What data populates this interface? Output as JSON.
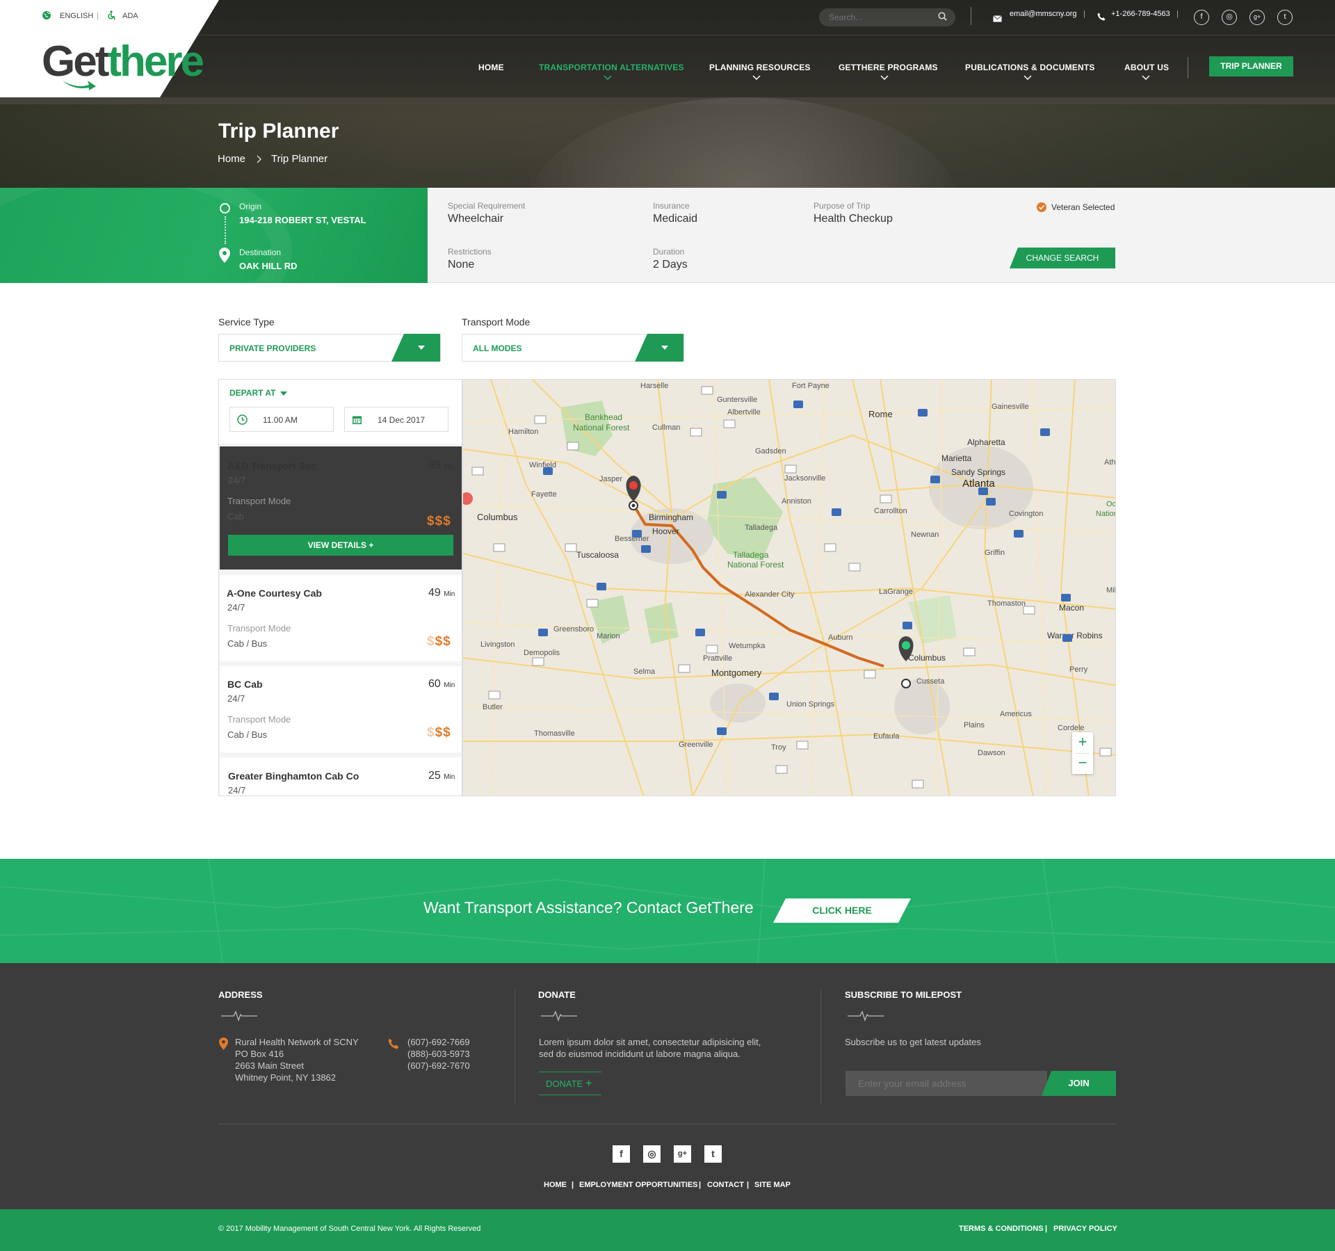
{
  "topbar": {
    "language": "ENGLISH",
    "ada": "ADA",
    "search_placeholder": "Search...",
    "email": "email@mmscny.org",
    "phone": "+1-266-789-4563"
  },
  "brand": {
    "logo_part1": "Get",
    "logo_part2": "there"
  },
  "nav": {
    "items": [
      "HOME",
      "TRANSPORTATION ALTERNATIVES",
      "PLANNING RESOURCES",
      "GETTHERE PROGRAMS",
      "PUBLICATIONS & DOCUMENTS",
      "ABOUT US"
    ],
    "cta": "TRIP PLANNER"
  },
  "hero": {
    "title": "Trip Planner",
    "breadcrumb": [
      "Home",
      "Trip Planner"
    ]
  },
  "trip": {
    "origin_label": "Origin",
    "origin": "194-218 ROBERT ST, VESTAL",
    "destination_label": "Destination",
    "destination": "OAK HILL RD"
  },
  "summary": {
    "special_label": "Special Requirement",
    "special": "Wheelchair",
    "insurance_label": "Insurance",
    "insurance": "Medicaid",
    "purpose_label": "Purpose of Trip",
    "purpose": "Health Checkup",
    "veteran": "Veteran Selected",
    "restrictions_label": "Restrictions",
    "restrictions": "None",
    "duration_label": "Duration",
    "duration": "2 Days",
    "change_button": "CHANGE SEARCH"
  },
  "filters": {
    "service_label": "Service Type",
    "service_value": "PRIVATE PROVIDERS",
    "mode_label": "Transport Mode",
    "mode_value": "ALL MODES"
  },
  "depart": {
    "label": "DEPART AT",
    "time": "11.00 AM",
    "date": "14 Dec 2017"
  },
  "results": [
    {
      "name": "A&D Transport Svc",
      "hours": "24/7",
      "minutes": "45",
      "min_unit": "Min",
      "mode_label": "Transport Mode",
      "mode": "Cab",
      "price": "$$$",
      "price_level": 3
    },
    {
      "name": "A-One Courtesy Cab",
      "hours": "24/7",
      "minutes": "49",
      "min_unit": "Min",
      "mode_label": "Transport Mode",
      "mode": "Cab / Bus",
      "price": "$$$",
      "price_level": 2
    },
    {
      "name": "BC Cab",
      "hours": "24/7",
      "minutes": "60",
      "min_unit": "Min",
      "mode_label": "Transport Mode",
      "mode": "Cab / Bus",
      "price": "$$$",
      "price_level": 2
    },
    {
      "name": "Greater Binghamton Cab Co",
      "hours": "24/7",
      "minutes": "25",
      "min_unit": "Min"
    }
  ],
  "view_details": "VIEW DETAILS +",
  "map": {
    "cities": [
      "Harselle",
      "Guntersville",
      "Fort Payne",
      "Rome",
      "Gainesville",
      "Albertville",
      "Hamilton",
      "Cullman",
      "Alpharetta",
      "Marietta",
      "Sandy Springs",
      "Atlanta",
      "Winfield",
      "Jasper",
      "Gadsden",
      "Jacksonville",
      "Fayette",
      "Columbus",
      "Birmingham",
      "Hoover",
      "Anniston",
      "Carrollton",
      "Covington",
      "Bessemer",
      "Talladega",
      "Newnan",
      "Griffin",
      "Tuscaloosa",
      "Alexander City",
      "LaGrange",
      "Thomaston",
      "Macon",
      "Greensboro",
      "Marion",
      "Livingston",
      "Demopolis",
      "Auburn",
      "Warner Robins",
      "Prattville",
      "Wetumpka",
      "Selma",
      "Montgomery",
      "Cusseta",
      "Perry",
      "Union Springs",
      "Butler",
      "Americus",
      "Thomasville",
      "Plains",
      "Cordele",
      "Greenville",
      "Troy",
      "Eufaula",
      "Dawson",
      "Athe",
      "Oco",
      "Nationa",
      "Mil",
      "Atlanta"
    ],
    "forests": [
      "Bankhead",
      "National Forest",
      "Talladega",
      "National Forest"
    ],
    "route_city": "Columbus",
    "zoom_in": "+",
    "zoom_out": "−"
  },
  "cta": {
    "text": "Want Transport Assistance? Contact GetThere",
    "button": "CLICK HERE"
  },
  "footer": {
    "address_head": "ADDRESS",
    "address": [
      "Rural Health Network of SCNY",
      "PO Box 416",
      "2663 Main Street",
      "Whitney Point, NY 13862"
    ],
    "phones": [
      "(607)-692-7669",
      "(888)-603-5973",
      "(607)-692-7670"
    ],
    "donate_head": "DONATE",
    "donate_text": [
      "Lorem ipsum dolor sit amet, consectetur adipisicing elit,",
      "sed do eiusmod incididunt ut labore magna aliqua."
    ],
    "donate_link": "DONATE",
    "subscribe_head": "SUBSCRIBE TO MILEPOST",
    "subscribe_text": "Subscribe us to get latest updates",
    "email_placeholder": "Enter your email address",
    "join": "JOIN",
    "links": [
      "HOME",
      "EMPLOYMENT OPPORTUNITIES",
      "CONTACT",
      "SITE MAP"
    ],
    "copyright": "© 2017 Mobility Management of South Central New York. All Rights Reserved",
    "terms": "TERMS & CONDITIONS",
    "privacy": "PRIVACY POLICY"
  },
  "colors": {
    "brand_green": "#1e9a55",
    "accent_orange": "#e07b2c",
    "dark": "#3c3c3c"
  }
}
